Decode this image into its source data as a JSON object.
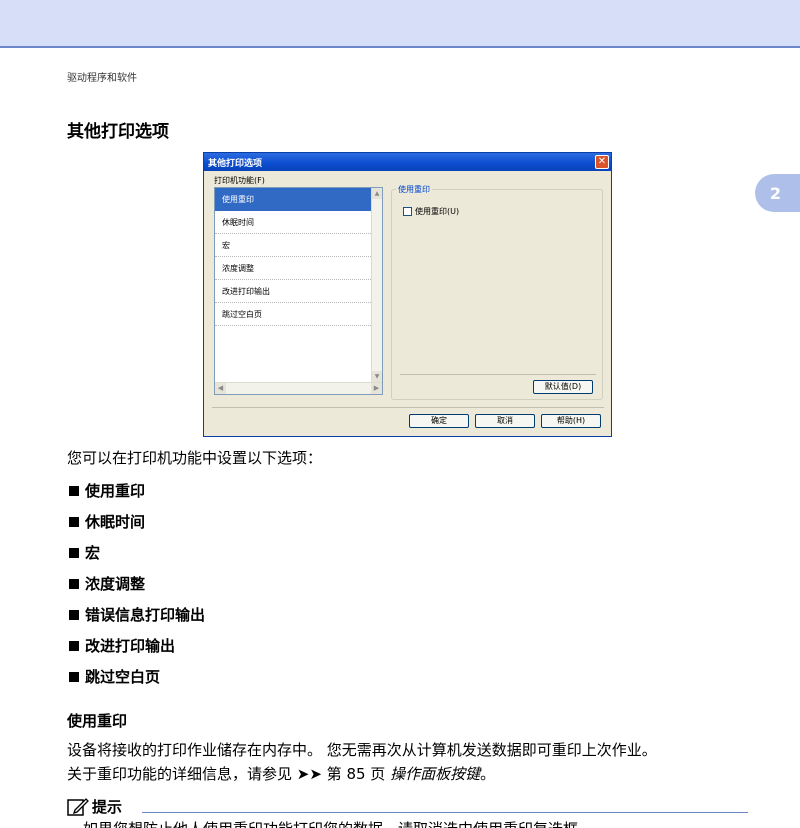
{
  "header": {
    "running_head": "驱动程序和软件",
    "chapter_tab": "2"
  },
  "section": {
    "title": "其他打印选项"
  },
  "dialog": {
    "title": "其他打印选项",
    "close_glyph": "✕",
    "group_label": "打印机功能(F)",
    "list_items": [
      {
        "label": "使用重印",
        "selected": true
      },
      {
        "label": "休眠时间",
        "selected": false
      },
      {
        "label": "宏",
        "selected": false
      },
      {
        "label": "浓度调整",
        "selected": false
      },
      {
        "label": "改进打印输出",
        "selected": false
      },
      {
        "label": "跳过空白页",
        "selected": false
      }
    ],
    "option_group_title": "使用重印",
    "checkbox_label": "使用重印(U)",
    "checkbox_checked": false,
    "default_button": "默认值(D)",
    "ok_button": "确定",
    "cancel_button": "取消",
    "help_button": "帮助(H)"
  },
  "content": {
    "intro": "您可以在打印机功能中设置以下选项：",
    "features": [
      "使用重印",
      "休眠时间",
      "宏",
      "浓度调整",
      "错误信息打印输出",
      "改进打印输出",
      "跳过空白页"
    ],
    "subsection_title": "使用重印",
    "body_line_1": "设备将接收的打印作业储存在内存中。 您无需再次从计算机发送数据即可重印上次作业。",
    "body_line_2_prefix": "关于重印功能的详细信息，请参见 ➤➤ 第 85 页 ",
    "body_line_2_link": "操作面板按键",
    "body_line_2_suffix": "。",
    "note_title": "提示",
    "note_text": "如果您想防止他人使用重印功能打印您的数据，请取消选中使用重印复选框。"
  },
  "colors": {
    "band": "#d6dff7",
    "accent": "#6b87c9",
    "selection": "#316ac5"
  },
  "icons": {
    "close": "close-icon",
    "note": "pencil-icon"
  }
}
